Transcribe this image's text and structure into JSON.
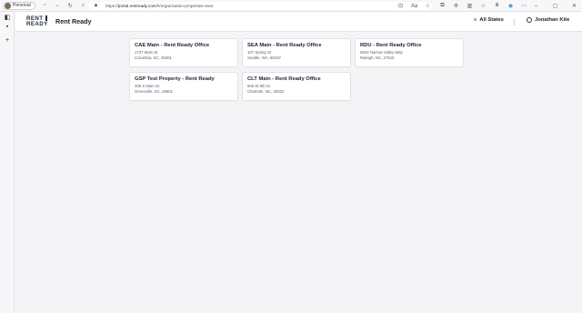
{
  "browser": {
    "profile_label": "Personal",
    "url_prefix": "https://",
    "url_host": "portal.rentready.com",
    "url_path": "/#/organization-properties-view"
  },
  "header": {
    "logo_line1": "RENT",
    "logo_line2": "READY",
    "brand": "Rent Ready",
    "states_label": "All States",
    "user_name": "Jonathan Kite"
  },
  "properties": [
    {
      "title": "CAE Main - Rent Ready Office",
      "street": "1737 Main St",
      "city": "Columbia, SC, 29201"
    },
    {
      "title": "SEA Main - Rent Ready Office",
      "street": "107 Spring St",
      "city": "Seattle, WA, 98107"
    },
    {
      "title": "RDU - Rent Ready Office",
      "street": "6503 Narrow Valley Way",
      "city": "Raleigh, NC, 27615"
    },
    {
      "title": "GSP Test Property - Rent Ready",
      "street": "206 S Main St",
      "city": "Greenville, SC, 29601"
    },
    {
      "title": "CLT Main - Rent Ready Office",
      "street": "506 W 5th St",
      "city": "Charlotte, NC, 28202"
    }
  ]
}
